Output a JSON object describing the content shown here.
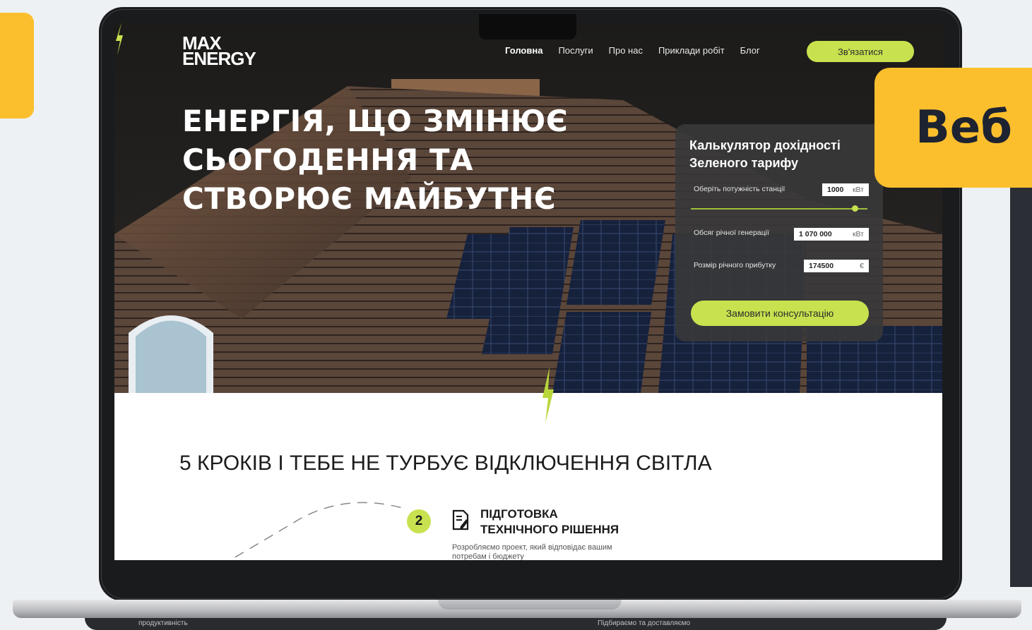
{
  "banner": {
    "text": "Веб"
  },
  "site": {
    "logo_line1": "MAX",
    "logo_line2": "ENERGY",
    "nav": [
      "Головна",
      "Послуги",
      "Про нас",
      "Приклади робіт",
      "Блог"
    ],
    "nav_active": "Головна",
    "cta_label": "Зв'язатися",
    "headline": "ЕНЕРГІЯ, ЩО ЗМІНЮЄ СЬОГОДЕННЯ ТА СТВОРЮЄ МАЙБУТНЄ"
  },
  "calculator": {
    "title": "Калькулятор дохідності Зеленого тарифу",
    "power_label": "Оберіть потужність станції",
    "power_value": "1000",
    "power_unit": "кВт",
    "slider_level": 0.93,
    "generation_label": "Обсяг річної генерації",
    "generation_value": "1 070 000",
    "generation_unit": "кВт",
    "profit_label": "Розмір річного прибутку",
    "profit_value": "174500",
    "profit_unit": "€",
    "button_label": "Замовити консультацію"
  },
  "steps": {
    "section_title": "5 КРОКІВ І ТЕБЕ НЕ ТУРБУЄ ВІДКЛЮЧЕННЯ СВІТЛА",
    "step_number": "2",
    "step_title_line1": "ПІДГОТОВКА",
    "step_title_line2": "ТЕХНІЧНОГО РІШЕННЯ",
    "step_desc": "Розробляємо проект, який відповідає вашим потребам і бюджету"
  },
  "below_screen": {
    "left_text": "продуктивність",
    "right_text": "Підбираємо та доставляємо"
  },
  "colors": {
    "accent": "#c8e24f",
    "banner": "#fbbf2e",
    "dark": "#1f1d1b"
  }
}
